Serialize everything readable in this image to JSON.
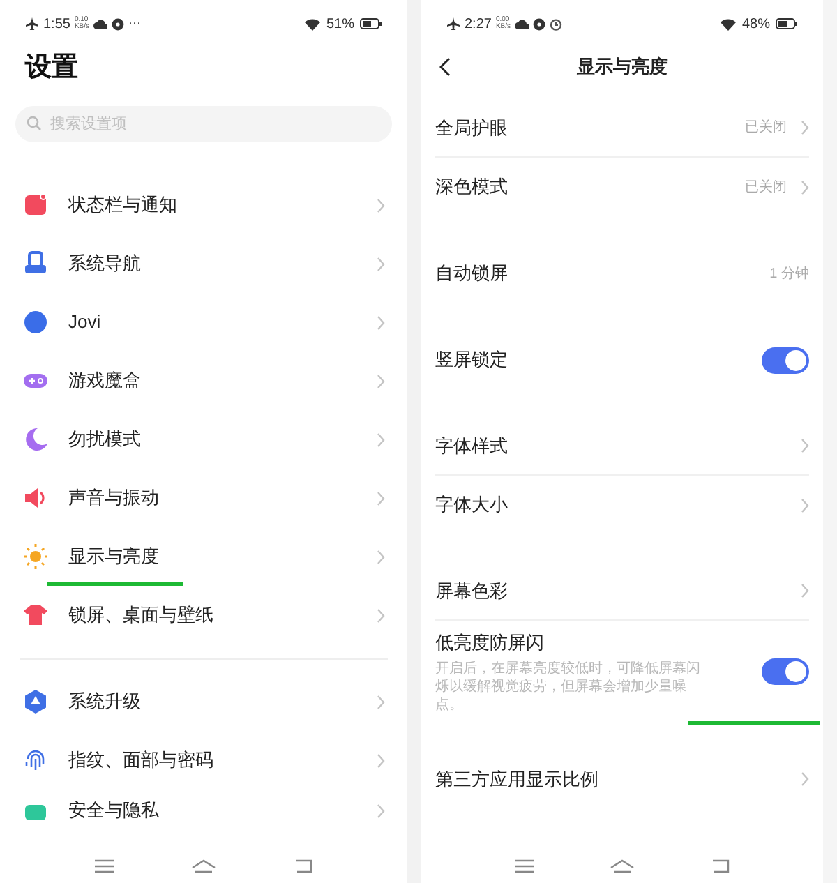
{
  "left": {
    "status_bar": {
      "time": "1:55",
      "speed": "0.10",
      "speed_unit": "KB/s",
      "more": "···",
      "battery": "51%"
    },
    "title": "设置",
    "search": {
      "placeholder": "搜索设置项"
    },
    "sections": [
      [
        {
          "label": "状态栏与通知",
          "underlined": false
        },
        {
          "label": "系统导航",
          "underlined": false
        },
        {
          "label": "Jovi",
          "underlined": false
        },
        {
          "label": "游戏魔盒",
          "underlined": false
        },
        {
          "label": "勿扰模式",
          "underlined": false
        },
        {
          "label": "声音与振动",
          "underlined": false
        },
        {
          "label": "显示与亮度",
          "underlined": true
        },
        {
          "label": "锁屏、桌面与壁纸",
          "underlined": false
        }
      ],
      [
        {
          "label": "系统升级",
          "underlined": false
        },
        {
          "label": "指纹、面部与密码",
          "underlined": false
        },
        {
          "label": "安全与隐私",
          "underlined": false
        }
      ]
    ]
  },
  "right": {
    "status_bar": {
      "time": "2:27",
      "speed": "0.00",
      "speed_unit": "KB/s",
      "battery": "48%"
    },
    "title": "显示与亮度",
    "sections": [
      [
        {
          "kind": "value",
          "label": "全局护眼",
          "value": "已关闭"
        },
        {
          "kind": "value",
          "label": "深色模式",
          "value": "已关闭"
        }
      ],
      [
        {
          "kind": "plain",
          "label": "自动锁屏",
          "value": "1 分钟"
        }
      ],
      [
        {
          "kind": "toggle",
          "label": "竖屏锁定",
          "on": true,
          "underlined": false
        }
      ],
      [
        {
          "kind": "chevron",
          "label": "字体样式"
        },
        {
          "kind": "chevron",
          "label": "字体大小"
        }
      ],
      [
        {
          "kind": "chevron",
          "label": "屏幕色彩"
        },
        {
          "kind": "toggle",
          "label": "低亮度防屏闪",
          "description": "开启后，在屏幕亮度较低时，可降低屏幕闪烁以缓解视觉疲劳，但屏幕会增加少量噪点。",
          "on": true,
          "underlined": true
        }
      ],
      [
        {
          "kind": "chevron",
          "label": "第三方应用显示比例"
        }
      ]
    ]
  }
}
